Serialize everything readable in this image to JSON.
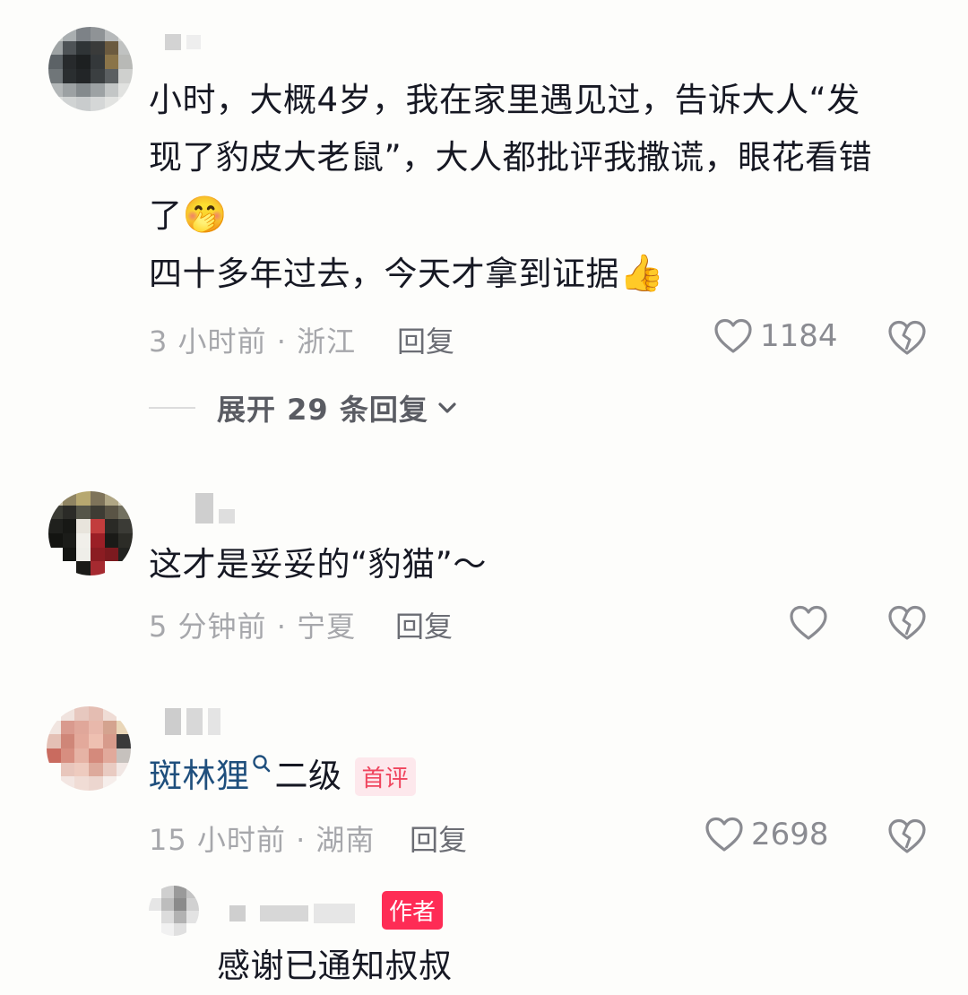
{
  "comments": [
    {
      "lines": [
        "小时，大概4岁，我在家里遇见过，告诉大人“发",
        "现了豹皮大老鼠”，大人都批评我撒谎，眼花看错",
        "了",
        "四十多年过去，今天才拿到证据"
      ],
      "emoji_after_line3": "🤭",
      "emoji_after_line4": "👍",
      "time": "3 小时前",
      "location": "浙江",
      "reply_label": "回复",
      "likes": "1184",
      "expand_label": "展开 29 条回复"
    },
    {
      "lines": [
        "这才是妥妥的“豹猫”～"
      ],
      "time": "5 分钟前",
      "location": "宁夏",
      "reply_label": "回复"
    },
    {
      "mention": "斑林狸",
      "text": "二级",
      "tag": "首评",
      "time": "15 小时前",
      "location": "湖南",
      "reply_label": "回复",
      "likes": "2698"
    }
  ],
  "sub_reply": {
    "author_tag": "作者",
    "text": "感谢已通知叔叔"
  },
  "colors": {
    "mention": "#1f4f7d",
    "first_comment_tag_bg": "#fde8ec",
    "first_comment_tag_text": "#f0455e",
    "author_tag_bg": "#fe2c55"
  },
  "icons": [
    "heart-outline-icon",
    "broken-heart-icon",
    "chevron-down-icon",
    "search-icon"
  ]
}
